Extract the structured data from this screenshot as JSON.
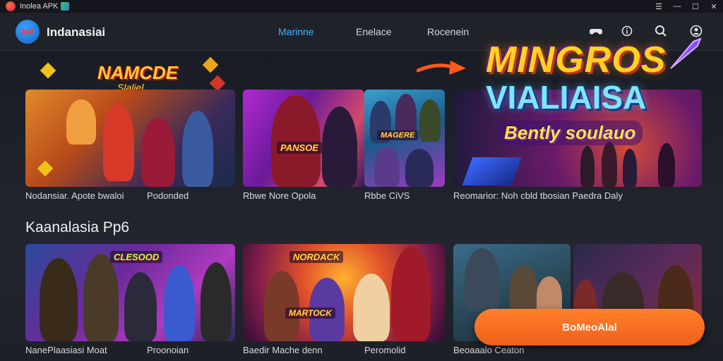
{
  "window": {
    "title": "Inolea APK"
  },
  "navbar": {
    "brand_logo_text": "NP",
    "brand_name": "Indanasiai",
    "links": [
      {
        "label": "Marinne",
        "active": true
      },
      {
        "label": "Enelace",
        "active": false
      },
      {
        "label": "Rocenein",
        "active": false
      }
    ],
    "icons": [
      "gamepad-icon",
      "info-icon",
      "search-icon",
      "user-icon"
    ]
  },
  "promo": {
    "small_logo": {
      "line1": "NAMCDE",
      "line2": "Slaliel"
    },
    "big_logo": {
      "line1": "MINGROS",
      "line2": "VIALIAISA",
      "line3": "Bently soulauo"
    }
  },
  "row1": {
    "captions": [
      "Nodansiar. Apote bwaloi",
      "Podonded",
      "Rbwe Nore Opola",
      "Rbbe CiVS",
      "Reomarior: Noh cbld tbosian Paedra Daly"
    ],
    "card_titles": [
      "PANSOE",
      "MAGERE"
    ]
  },
  "section": {
    "title": "Kaanalasia Pp6"
  },
  "row2": {
    "captions": [
      "NanePlaasiasi Moat",
      "Proonoian",
      "Baedir Mache denn",
      "Peromolid",
      "Beoaaalo Ceaton"
    ],
    "card_titles": [
      "CLESOOD",
      "NORDACK",
      "MARTOCK"
    ]
  },
  "cta": {
    "label": "BoMeoAlal"
  },
  "colors": {
    "accent": "#3fb6ff",
    "cta": "#f0601a",
    "background": "#1d1f26"
  }
}
